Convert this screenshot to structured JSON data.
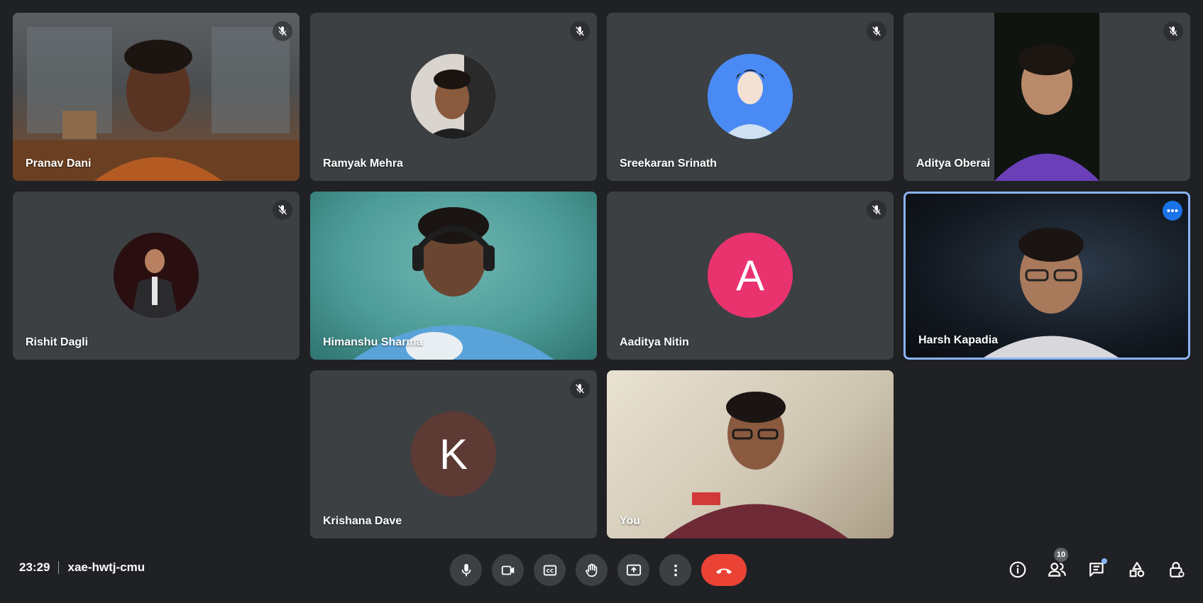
{
  "participants": [
    {
      "name": "Pranav Dani"
    },
    {
      "name": "Ramyak Mehra"
    },
    {
      "name": "Sreekaran Srinath"
    },
    {
      "name": "Aditya Oberai"
    },
    {
      "name": "Rishit Dagli"
    },
    {
      "name": "Himanshu Sharma"
    },
    {
      "name": "Aaditya Nitin",
      "avatar_letter": "A",
      "avatar_color": "#e8336e"
    },
    {
      "name": "Harsh Kapadia"
    },
    {
      "name": "Krishana Dave",
      "avatar_letter": "K",
      "avatar_color": "#5d3a34"
    },
    {
      "name": "You"
    }
  ],
  "meeting": {
    "time": "23:29",
    "code": "xae-hwtj-cmu"
  },
  "toolbar": {
    "people_count": "10"
  },
  "colors": {
    "background": "#202124",
    "tile": "#3c4043",
    "active_border": "#8ab4f8",
    "end_call": "#ea4335",
    "accent": "#1a73e8"
  },
  "icons": {
    "mic": "microphone-icon",
    "camera": "camera-icon",
    "captions": "closed-captions-icon",
    "raise_hand": "raise-hand-icon",
    "present": "present-screen-icon",
    "more": "more-options-icon",
    "end": "end-call-icon",
    "info": "info-icon",
    "people": "people-icon",
    "chat": "chat-icon",
    "activities": "activities-icon",
    "host_controls": "host-controls-icon"
  }
}
